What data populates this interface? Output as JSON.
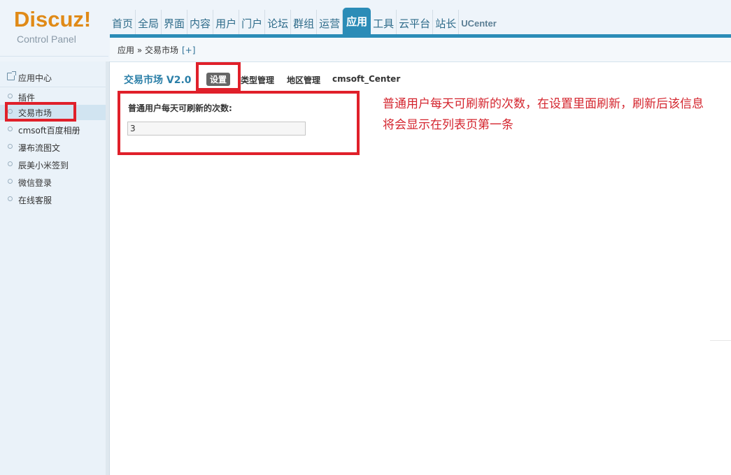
{
  "logo": {
    "main": "Discuz!",
    "sub": "Control Panel"
  },
  "topnav": {
    "items": [
      "首页",
      "全局",
      "界面",
      "内容",
      "用户",
      "门户",
      "论坛",
      "群组",
      "运营",
      "应用",
      "工具",
      "云平台",
      "站长",
      "UCenter"
    ],
    "active": "应用"
  },
  "breadcrumb": {
    "text": "应用 » 交易市场",
    "add": "[+]"
  },
  "sidebar": {
    "header": "应用中心",
    "items": [
      "插件",
      "交易市场",
      "cmsoft百度相册",
      "瀑布流图文",
      "辰美小米签到",
      "微信登录",
      "在线客服"
    ],
    "active": "交易市场"
  },
  "main": {
    "title": "交易市场 V2.0",
    "tabs": [
      "设置",
      "类型管理",
      "地区管理",
      "cmsoft_Center"
    ],
    "active_tab": "设置",
    "form": {
      "label": "普通用户每天可刷新的次数:",
      "value": "3"
    },
    "annotation": "普通用户每天可刷新的次数，在设置里面刷新，刷新后该信息将会显示在列表页第一条"
  },
  "colors": {
    "accent": "#2b8cb7",
    "logo": "#e08a17",
    "highlight": "#e0202a"
  }
}
